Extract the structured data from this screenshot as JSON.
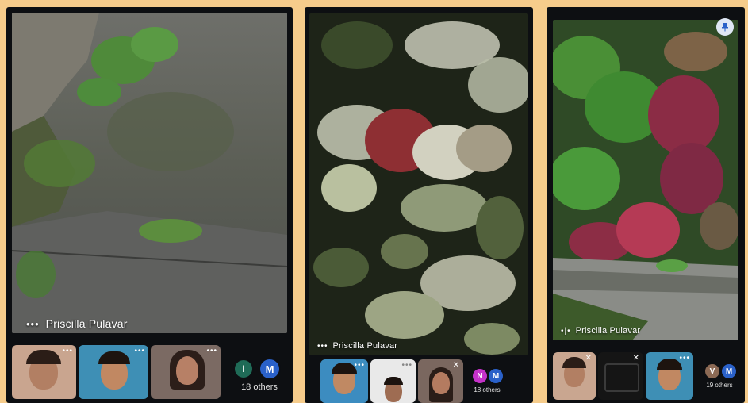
{
  "screens": [
    {
      "main_name": "Priscilla Pulavar",
      "others_label": "18 others",
      "avatars": [
        {
          "letter": "I",
          "color": "#1f6b57"
        },
        {
          "letter": "M",
          "color": "#2a61c9"
        }
      ]
    },
    {
      "main_name": "Priscilla Pulavar",
      "others_label": "18 others",
      "avatars": [
        {
          "letter": "N",
          "color": "#c532c9"
        },
        {
          "letter": "M",
          "color": "#2a61c9"
        }
      ]
    },
    {
      "main_name": "Priscilla Pulavar",
      "others_label": "19 others",
      "avatars": [
        {
          "letter": "V",
          "color": "#8c6a55"
        },
        {
          "letter": "M",
          "color": "#2a61c9"
        }
      ]
    }
  ],
  "icons": {
    "more": "more-options-icon",
    "audio": "audio-level-icon",
    "pin": "pin-icon",
    "mic_off": "mic-off-icon"
  },
  "colors": {
    "background": "#f6cc8b",
    "phone": "#0d0f12"
  }
}
